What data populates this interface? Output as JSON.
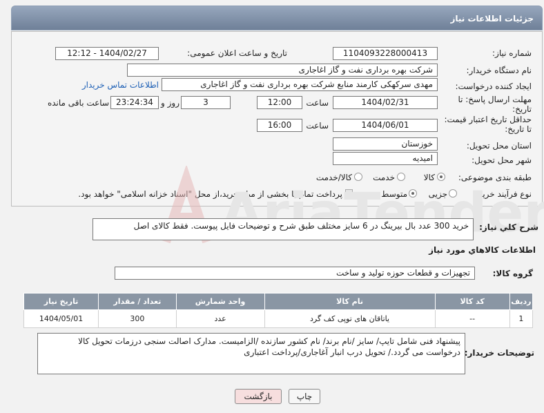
{
  "header": {
    "title": "جزئیات اطلاعات نیاز"
  },
  "form": {
    "need_number_label": "شماره نیاز:",
    "need_number": "1104093228000413",
    "announce_label": "تاریخ و ساعت اعلان عمومی:",
    "announce_value": "1404/02/27 - 12:12",
    "buyer_org_label": "نام دستگاه خریدار:",
    "buyer_org": "شرکت بهره برداری نفت و گاز اغاجاری",
    "creator_label": "ایجاد کننده درخواست:",
    "creator": "مهدی سرکهکی کارمند منابع شرکت بهره برداری نفت و گاز اغاجاری",
    "contact_link": "اطلاعات تماس خریدار",
    "deadline_label_1": "مهلت ارسال پاسخ: تا",
    "deadline_label_2": "تاریخ:",
    "deadline_date": "1404/02/31",
    "time_label": "ساعت",
    "deadline_time": "12:00",
    "days_value": "3",
    "day_word": "روز و",
    "remaining_time": "23:24:34",
    "remaining_label": "ساعت باقی مانده",
    "validity_label_1": "حداقل تاریخ اعتبار قیمت:",
    "validity_label_2": "تا تاریخ:",
    "validity_date": "1404/06/01",
    "validity_time": "16:00",
    "province_label": "استان محل تحویل:",
    "province": "خوزستان",
    "city_label": "شهر محل تحویل:",
    "city": "امیدیه",
    "category_label": "طبقه بندی موضوعی:",
    "category_options": [
      "کالا",
      "خدمت",
      "کالا/خدمت"
    ],
    "process_label": "نوع فرآیند خرید :",
    "process_options": [
      "جزیی",
      "متوسط"
    ],
    "payment_note": "پرداخت تمام یا بخشی از مبلغ خرید،از محل \"اسناد خزانه اسلامی\" خواهد بود."
  },
  "description": {
    "label": "شرح کلي نياز:",
    "text": "خرید 300 عدد بال بیرینگ در 6 سایز مختلف طبق شرح و توضیحات فایل پیوست. فقط کالای اصل"
  },
  "goods": {
    "section_title": "اطلاعات کالاهاي مورد نياز",
    "group_label": "گروه کالا:",
    "group_value": "تجهیزات و قطعات حوزه تولید و ساخت",
    "columns": [
      "ردیف",
      "کد کالا",
      "نام کالا",
      "واحد شمارش",
      "تعداد / مقدار",
      "تاریخ نیاز"
    ],
    "rows": [
      [
        "1",
        "--",
        "یاتاقان های توپی کف گرد",
        "عدد",
        "300",
        "1404/05/01"
      ]
    ]
  },
  "buyer_notes": {
    "label": "توضیحات خریدار:",
    "text": "پیشنهاد فنی شامل تایپ/ سایز /نام برند/ نام کشور سازنده /الزامیست. مدارک اصالت سنجی درزمات تحویل کالا درخواست می گردد./ تحویل درب انبار آغاجاری/پرداخت اعتباری"
  },
  "buttons": {
    "print": "چاپ",
    "back": "بازگشت"
  },
  "watermark": {
    "text": "AriaTender.neT"
  },
  "colors": {
    "title_bar": "#7f8fa6",
    "table_header": "#8a96a4",
    "link": "#1d5fb5",
    "back_button": "#f7dede"
  }
}
